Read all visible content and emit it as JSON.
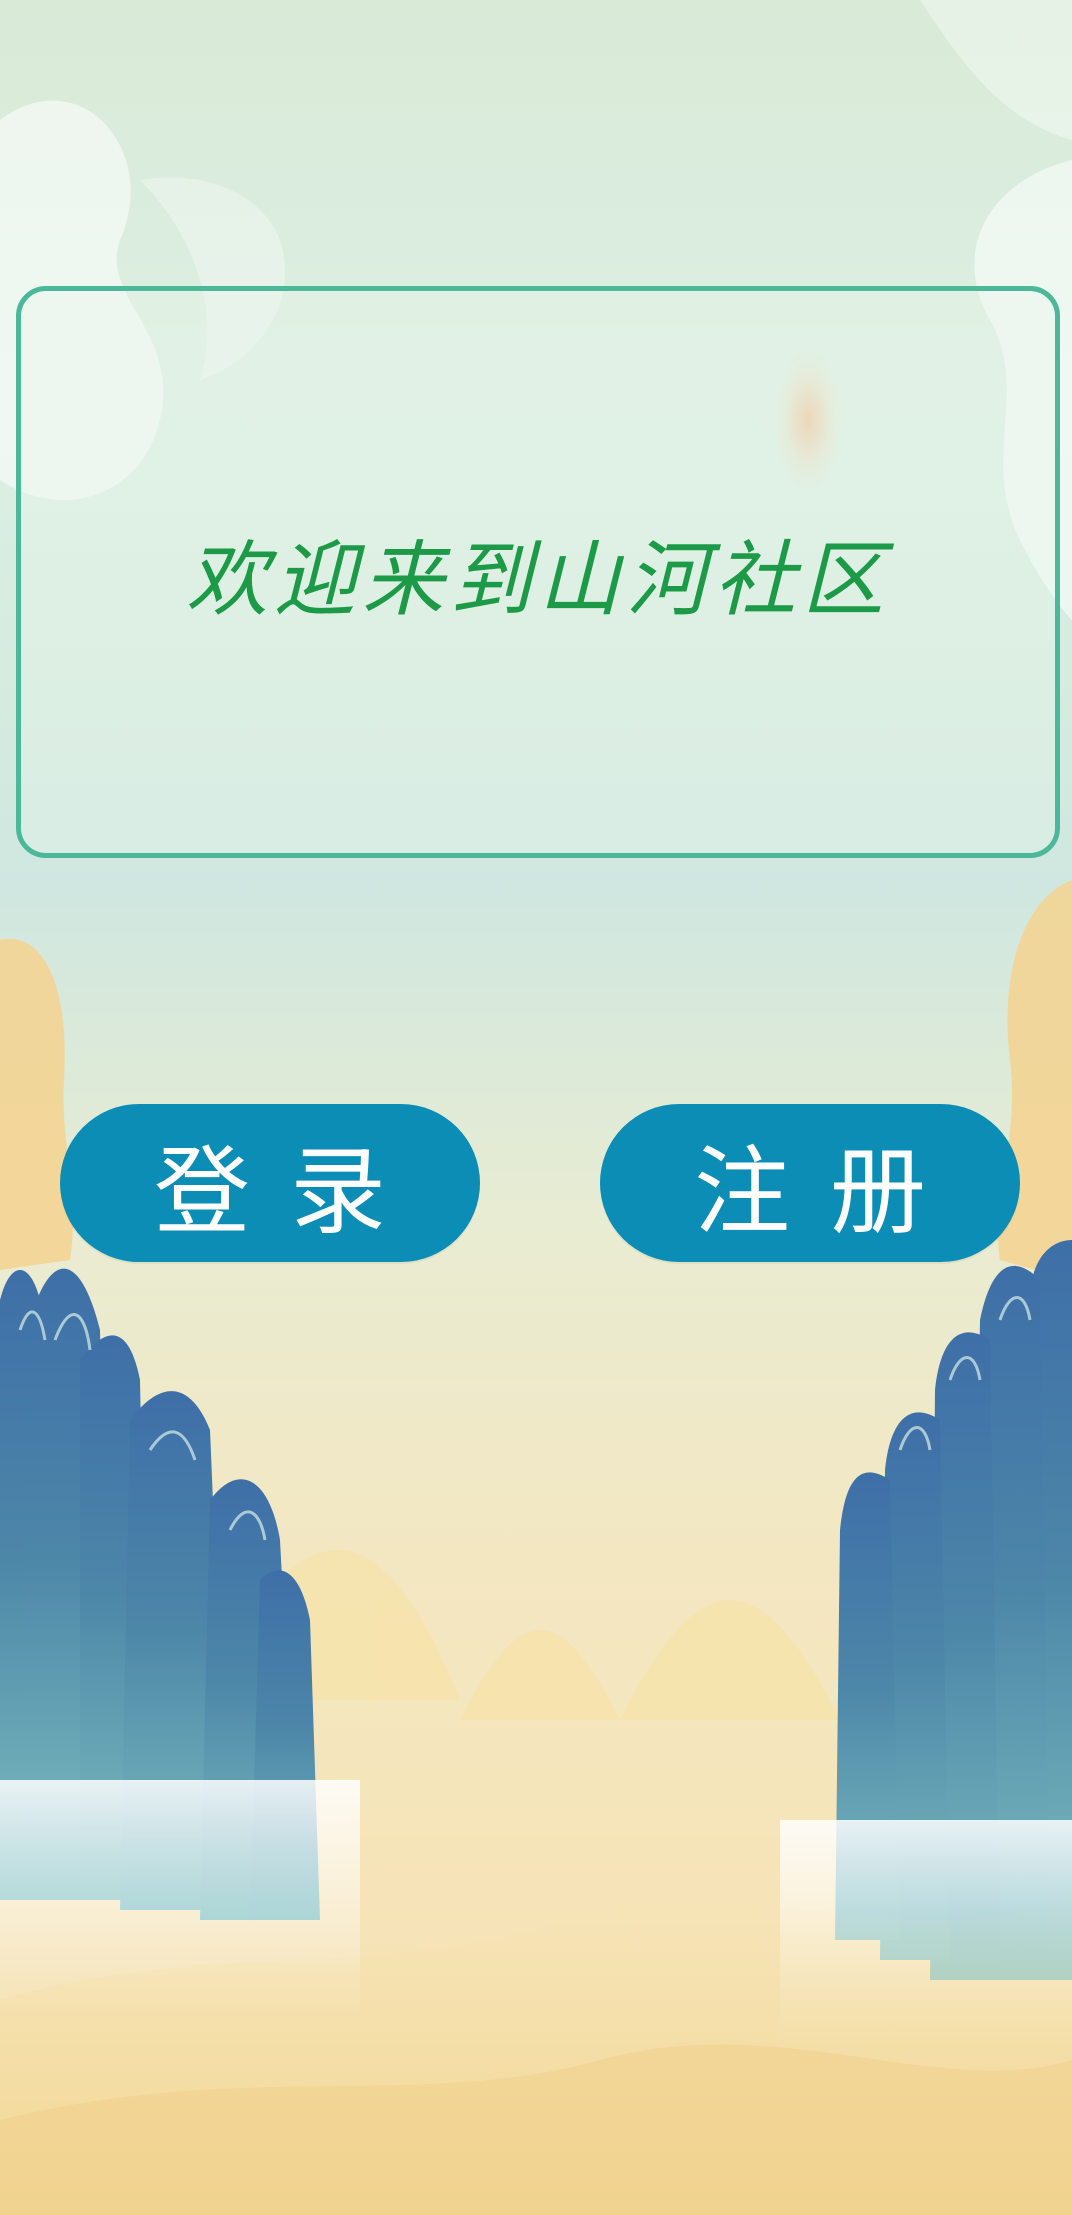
{
  "welcome": {
    "title": "欢迎来到山河社区"
  },
  "actions": {
    "login_label": "登录",
    "register_label": "注册"
  },
  "colors": {
    "card_border": "#4cb89a",
    "title_text": "#1d9a47",
    "button_fill": "#0b8db5",
    "button_text": "#ffffff"
  }
}
